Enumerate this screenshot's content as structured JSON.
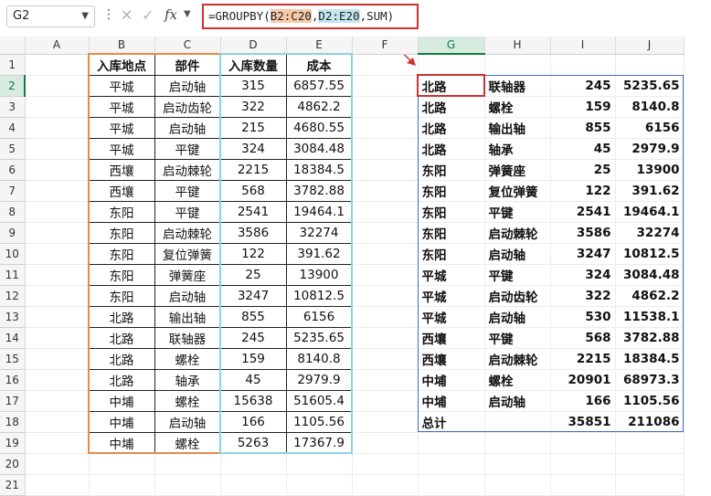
{
  "name_box": "G2",
  "formula": {
    "prefix": "=GROUPBY(",
    "ref1": "B2:C20",
    "sep": ",",
    "ref2": "D2:E20",
    "suffix": ",SUM)"
  },
  "icons": {
    "more": "more-vertical-icon",
    "cancel": "cancel-x-icon",
    "enter": "check-icon",
    "fx": "function-icon"
  },
  "fx_label": "fx",
  "selected_column": "G",
  "selected_row": 2,
  "columns": [
    "A",
    "B",
    "C",
    "D",
    "E",
    "F",
    "G",
    "H",
    "I",
    "J"
  ],
  "rows": [
    1,
    2,
    3,
    4,
    5,
    6,
    7,
    8,
    9,
    10,
    11,
    12,
    13,
    14,
    15,
    16,
    17,
    18,
    19,
    20,
    21
  ],
  "source_table": {
    "headers": [
      "入库地点",
      "部件",
      "入库数量",
      "成本"
    ],
    "rows": [
      [
        "平城",
        "启动轴",
        "315",
        "6857.55"
      ],
      [
        "平城",
        "启动齿轮",
        "322",
        "4862.2"
      ],
      [
        "平城",
        "启动轴",
        "215",
        "4680.55"
      ],
      [
        "平城",
        "平键",
        "324",
        "3084.48"
      ],
      [
        "西壤",
        "启动棘轮",
        "2215",
        "18384.5"
      ],
      [
        "西壤",
        "平键",
        "568",
        "3782.88"
      ],
      [
        "东阳",
        "平键",
        "2541",
        "19464.1"
      ],
      [
        "东阳",
        "启动棘轮",
        "3586",
        "32274"
      ],
      [
        "东阳",
        "复位弹簧",
        "122",
        "391.62"
      ],
      [
        "东阳",
        "弹簧座",
        "25",
        "13900"
      ],
      [
        "东阳",
        "启动轴",
        "3247",
        "10812.5"
      ],
      [
        "北路",
        "输出轴",
        "855",
        "6156"
      ],
      [
        "北路",
        "联轴器",
        "245",
        "5235.65"
      ],
      [
        "北路",
        "螺栓",
        "159",
        "8140.8"
      ],
      [
        "北路",
        "轴承",
        "45",
        "2979.9"
      ],
      [
        "中埔",
        "螺栓",
        "15638",
        "51605.4"
      ],
      [
        "中埔",
        "启动轴",
        "166",
        "1105.56"
      ],
      [
        "中埔",
        "螺栓",
        "5263",
        "17367.9"
      ]
    ]
  },
  "result_table": {
    "rows": [
      [
        "北路",
        "联轴器",
        "245",
        "5235.65"
      ],
      [
        "北路",
        "螺栓",
        "159",
        "8140.8"
      ],
      [
        "北路",
        "输出轴",
        "855",
        "6156"
      ],
      [
        "北路",
        "轴承",
        "45",
        "2979.9"
      ],
      [
        "东阳",
        "弹簧座",
        "25",
        "13900"
      ],
      [
        "东阳",
        "复位弹簧",
        "122",
        "391.62"
      ],
      [
        "东阳",
        "平键",
        "2541",
        "19464.1"
      ],
      [
        "东阳",
        "启动棘轮",
        "3586",
        "32274"
      ],
      [
        "东阳",
        "启动轴",
        "3247",
        "10812.5"
      ],
      [
        "平城",
        "平键",
        "324",
        "3084.48"
      ],
      [
        "平城",
        "启动齿轮",
        "322",
        "4862.2"
      ],
      [
        "平城",
        "启动轴",
        "530",
        "11538.1"
      ],
      [
        "西壤",
        "平键",
        "568",
        "3782.88"
      ],
      [
        "西壤",
        "启动棘轮",
        "2215",
        "18384.5"
      ],
      [
        "中埔",
        "螺栓",
        "20901",
        "68973.3"
      ],
      [
        "中埔",
        "启动轴",
        "166",
        "1105.56"
      ]
    ],
    "total_label": "总计",
    "total_qty": "35851",
    "total_cost": "211086"
  },
  "colors": {
    "formula_border": "#d03030",
    "ref1": "#f7c9a9",
    "ref2": "#c3e6f1",
    "spill": "#3f6cc0",
    "orange_range": "#e98a43",
    "blue_range": "#8bd3e0",
    "selection": "#107c41"
  }
}
